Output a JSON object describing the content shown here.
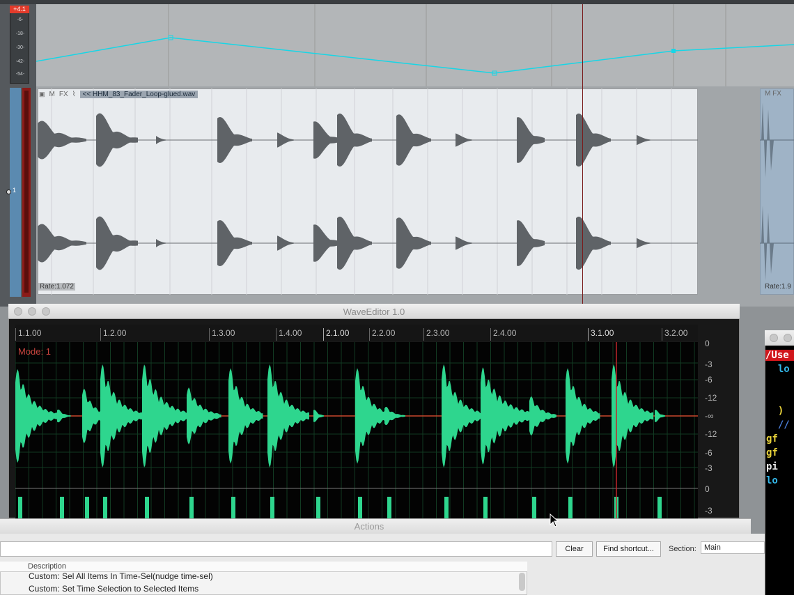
{
  "arrange": {
    "vu_peak": "+4.1",
    "vu_ticks": [
      "-6-",
      "-18-",
      "-30-",
      "-42-",
      "-54-"
    ],
    "track_number": "1",
    "item": {
      "name": "<< HHM_83_Fader_Loop-glued.wav",
      "lock_label": "🔒",
      "mute_label": "M",
      "fx_label": "FX",
      "rate": "Rate:1.072"
    },
    "item_right": {
      "header": "M FX",
      "rate": "Rate:1.9"
    },
    "envelope_color": "#17d6e6"
  },
  "wave_editor": {
    "title": "WaveEditor 1.0",
    "mode": "Mode: 1",
    "ruler_labels": [
      "1.1.00",
      "1.2.00",
      "1.3.00",
      "1.4.00",
      "2.1.00",
      "2.2.00",
      "2.3.00",
      "2.4.00",
      "3.1.00",
      "3.2.00"
    ],
    "db_labels": [
      "0",
      "-3",
      "-6",
      "-12",
      "-∞",
      "-12",
      "-6",
      "-3",
      "0",
      "-3"
    ],
    "waveform_color": "#2ed68e",
    "playhead_color": "#c0262a"
  },
  "script_editor": {
    "lines": [
      "/Use",
      "  lo",
      " ",
      " ",
      "  )",
      "  //",
      "gf",
      "gf",
      "pi",
      "lo"
    ]
  },
  "actions": {
    "title": "Actions",
    "clear_label": "Clear",
    "find_shortcut_label": "Find shortcut...",
    "section_label": "Section:",
    "section_value": "Main",
    "column_description": "Description",
    "rows": [
      "Custom: Sel All Items In Time-Sel(nudge time-sel)",
      "Custom: Set Time Selection to Selected Items"
    ]
  }
}
